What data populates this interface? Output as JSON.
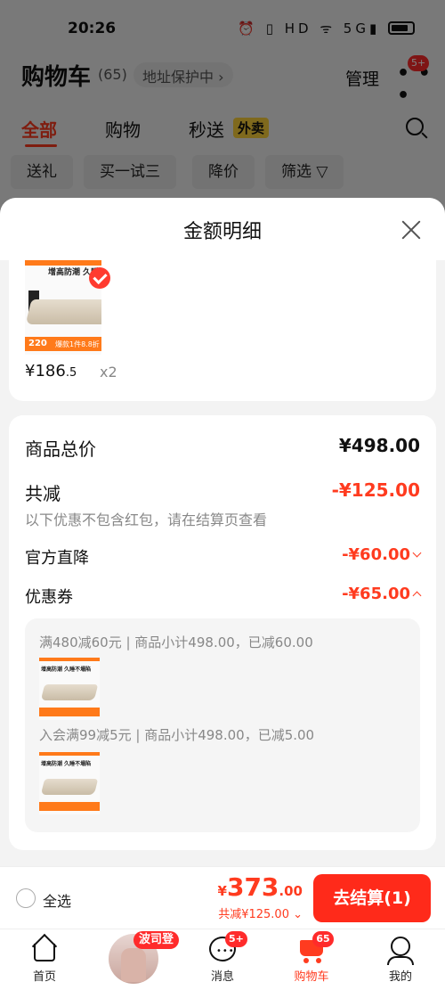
{
  "status": {
    "time": "20:26",
    "icons_text": "⏰ ▯ HD ᯤ 5G▮"
  },
  "background": {
    "title": "购物车",
    "count": "(65)",
    "address_protection": "地址保护中 ›",
    "manage": "管理",
    "more_badge": "5+",
    "tabs": [
      {
        "label": "全部",
        "active": true
      },
      {
        "label": "购物",
        "active": false
      },
      {
        "label": "秒送",
        "active": false
      }
    ],
    "waimai_badge": "外卖",
    "chips": [
      "送礼",
      "买一试三",
      "降价",
      "筛选 ▽"
    ]
  },
  "sheet": {
    "title": "金额明细",
    "product": {
      "headline": "增高防潮 久睡不",
      "price_int": "¥186",
      "price_dec": ".5",
      "qty": "x2",
      "img_price": "220",
      "img_label": "爆款1件8.8折"
    },
    "rows": {
      "total_label": "商品总价",
      "total_value": "¥498.00",
      "discount_label": "共减",
      "discount_value": "-¥125.00",
      "note": "以下优惠不包含红包，请在结算页查看",
      "official_label": "官方直降",
      "official_value": "-¥60.00",
      "coupon_label": "优惠券",
      "coupon_value": "-¥65.00"
    },
    "coupons": [
      {
        "text": "满480减60元 | 商品小计498.00，已减60.00"
      },
      {
        "text": "入会满99减5元 | 商品小计498.00，已减5.00"
      }
    ],
    "mini_headline": "增高防潮 久睡不塌陷"
  },
  "bottom": {
    "select_all": "全选",
    "total_yen": "¥",
    "total_int": "373",
    "total_dec": ".00",
    "saved": "共减¥125.00 ⌄",
    "checkout": "去结算(1)"
  },
  "tabbar": {
    "promo_badge": "波司登",
    "items": [
      {
        "label": "首页"
      },
      {
        "label": "消息",
        "badge": "5+"
      },
      {
        "label": "购物车",
        "badge": "65"
      },
      {
        "label": "我的"
      }
    ]
  },
  "colors": {
    "accent": "#ff3b1f",
    "checkout": "#ff2a1a",
    "badge": "#ff2b2b",
    "waimai": "#ffd23a"
  }
}
